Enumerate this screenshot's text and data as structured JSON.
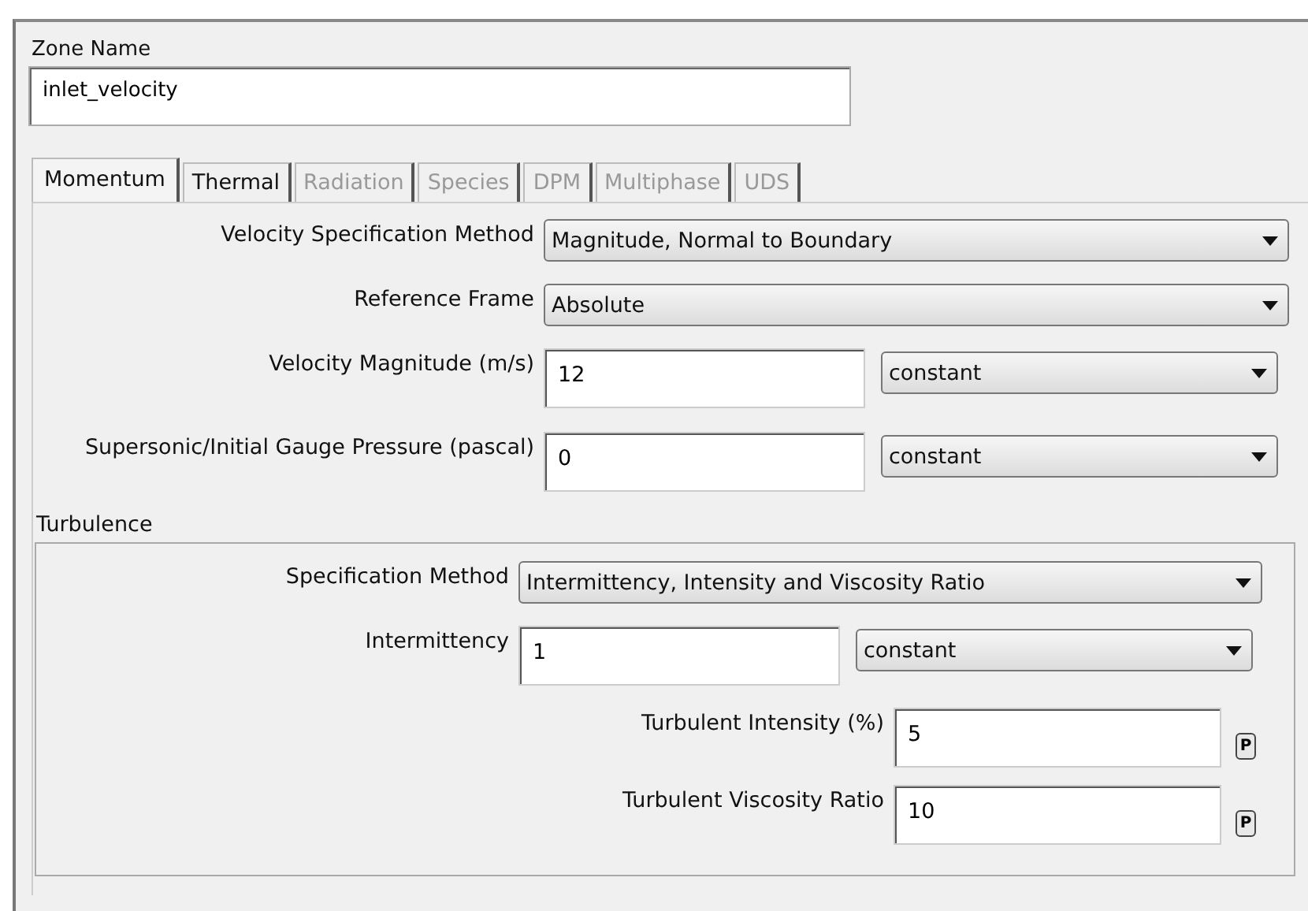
{
  "zone_name": {
    "label": "Zone Name",
    "value": "inlet_velocity"
  },
  "tabs": [
    {
      "label": "Momentum",
      "selected": true,
      "disabled": false
    },
    {
      "label": "Thermal",
      "selected": false,
      "disabled": false
    },
    {
      "label": "Radiation",
      "selected": false,
      "disabled": true
    },
    {
      "label": "Species",
      "selected": false,
      "disabled": true
    },
    {
      "label": "DPM",
      "selected": false,
      "disabled": true
    },
    {
      "label": "Multiphase",
      "selected": false,
      "disabled": true
    },
    {
      "label": "UDS",
      "selected": false,
      "disabled": true
    }
  ],
  "momentum_fields": [
    {
      "kind": "select",
      "label": "Velocity Specification Method",
      "option": "Magnitude, Normal to Boundary"
    },
    {
      "kind": "select",
      "label": "Reference Frame",
      "option": "Absolute"
    },
    {
      "kind": "input-select",
      "label": "Velocity Magnitude (m/s)",
      "value": "12",
      "option": "constant"
    },
    {
      "kind": "input-select",
      "label": "Supersonic/Initial Gauge Pressure (pascal)",
      "value": "0",
      "option": "constant"
    }
  ],
  "turbulence": {
    "title": "Turbulence",
    "fields": [
      {
        "kind": "select",
        "label": "Specification Method",
        "option": "Intermittency, Intensity and Viscosity Ratio"
      },
      {
        "kind": "input-select",
        "label": "Intermittency",
        "value": "1",
        "option": "constant"
      },
      {
        "kind": "input-param",
        "label": "Turbulent Intensity (%)",
        "value": "5",
        "button": "P"
      },
      {
        "kind": "input-param",
        "label": "Turbulent Viscosity Ratio",
        "value": "10",
        "button": "P"
      }
    ]
  }
}
